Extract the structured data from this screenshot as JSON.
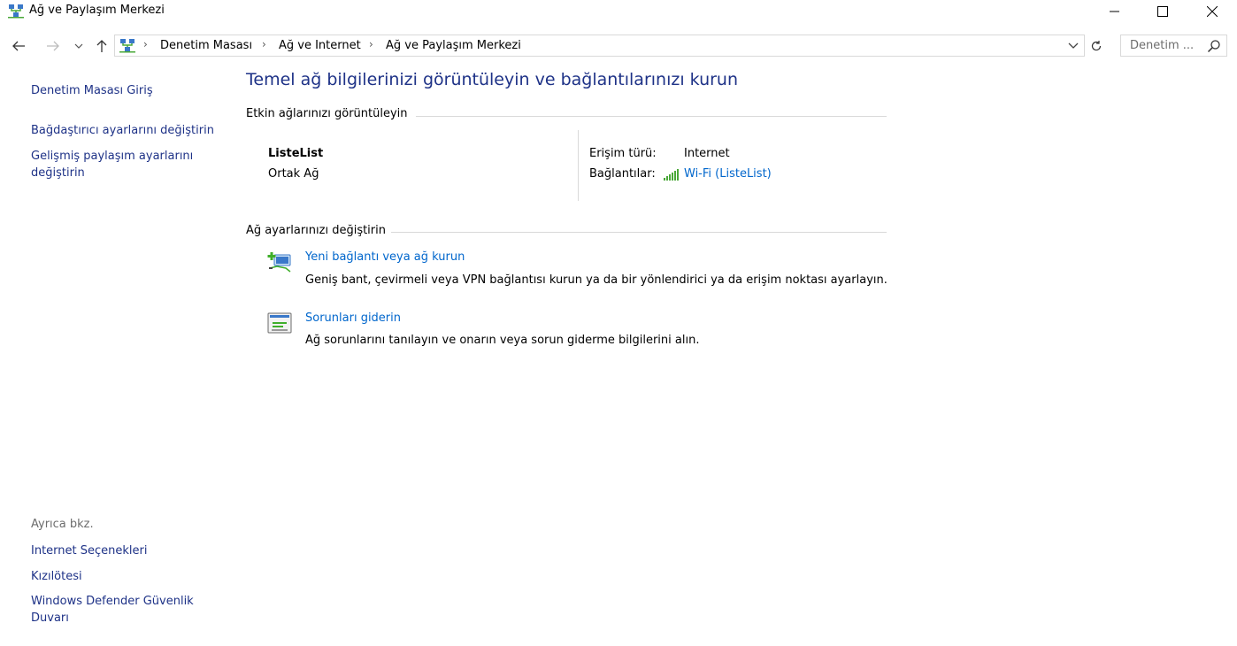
{
  "window": {
    "title": "Ağ ve Paylaşım Merkezi",
    "controls": {
      "minimize": "minimize-icon",
      "maximize": "maximize-icon",
      "close": "close-icon"
    }
  },
  "address": {
    "breadcrumbs": [
      "Denetim Masası",
      "Ağ ve Internet",
      "Ağ ve Paylaşım Merkezi"
    ],
    "search_placeholder": "Denetim ..."
  },
  "sidebar": {
    "home": "Denetim Masası Giriş",
    "adapter_settings": "Bağdaştırıcı ayarlarını değiştirin",
    "sharing_settings": "Gelişmiş paylaşım ayarlarını değiştirin",
    "see_also": {
      "heading": "Ayrıca bkz.",
      "items": [
        "Internet Seçenekleri",
        "Kızılötesi",
        "Windows Defender Güvenlik Duvarı"
      ]
    }
  },
  "main": {
    "title": "Temel ağ bilgilerinizi görüntüleyin ve bağlantılarınızı kurun",
    "active_networks": {
      "heading": "Etkin ağlarınızı görüntüleyin",
      "network_name": "ListeList",
      "network_type": "Ortak Ağ",
      "access_type_label": "Erişim türü:",
      "access_type_value": "Internet",
      "connections_label": "Bağlantılar:",
      "connection_link": "Wi-Fi (ListeList)"
    },
    "change_settings": {
      "heading": "Ağ ayarlarınızı değiştirin",
      "tasks": [
        {
          "link": "Yeni bağlantı veya ağ kurun",
          "description": "Geniş bant, çevirmeli veya VPN bağlantısı kurun ya da bir yönlendirici ya da erişim noktası ayarlayın.",
          "icon": "new-network-icon"
        },
        {
          "link": "Sorunları giderin",
          "description": "Ağ sorunlarını tanılayın ve onarın veya sorun giderme bilgilerini alın.",
          "icon": "troubleshoot-icon"
        }
      ]
    }
  },
  "colors": {
    "link": "#0066cc",
    "nav_link": "#1e3287",
    "muted": "#6d6d6d",
    "divider": "#d9d9d9"
  }
}
